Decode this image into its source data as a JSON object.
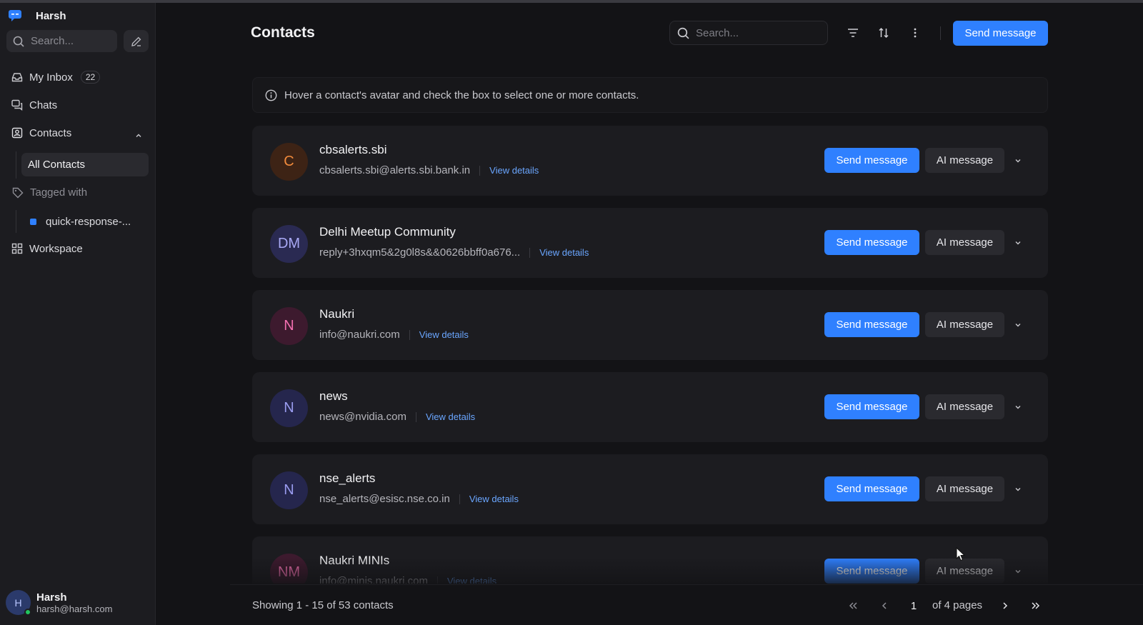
{
  "sidebar": {
    "brand": "Harsh",
    "search_placeholder": "Search...",
    "nav": {
      "inbox_label": "My Inbox",
      "inbox_count": "22",
      "chats_label": "Chats",
      "contacts_label": "Contacts",
      "all_contacts_label": "All Contacts",
      "tagged_label": "Tagged with",
      "tag_item_label": "quick-response-...",
      "workspace_label": "Workspace"
    },
    "user": {
      "initial": "H",
      "name": "Harsh",
      "email": "harsh@harsh.com"
    }
  },
  "header": {
    "title": "Contacts",
    "search_placeholder": "Search...",
    "send_message_label": "Send message"
  },
  "info": {
    "text": "Hover a contact's avatar and check the box to select one or more contacts."
  },
  "contacts": [
    {
      "initials": "C",
      "name": "cbsalerts.sbi",
      "email": "cbsalerts.sbi@alerts.sbi.bank.in",
      "view_label": "View details",
      "send_label": "Send message",
      "ai_label": "AI message"
    },
    {
      "initials": "DM",
      "name": "Delhi Meetup Community",
      "email": "reply+3hxqm5&2g0l8s&&0626bbff0a676...",
      "view_label": "View details",
      "send_label": "Send message",
      "ai_label": "AI message"
    },
    {
      "initials": "N",
      "name": "Naukri",
      "email": "info@naukri.com",
      "view_label": "View details",
      "send_label": "Send message",
      "ai_label": "AI message"
    },
    {
      "initials": "N",
      "name": "news",
      "email": "news@nvidia.com",
      "view_label": "View details",
      "send_label": "Send message",
      "ai_label": "AI message"
    },
    {
      "initials": "N",
      "name": "nse_alerts",
      "email": "nse_alerts@esisc.nse.co.in",
      "view_label": "View details",
      "send_label": "Send message",
      "ai_label": "AI message"
    },
    {
      "initials": "NM",
      "name": "Naukri MINIs",
      "email": "info@minis.naukri.com",
      "view_label": "View details",
      "send_label": "Send message",
      "ai_label": "AI message"
    }
  ],
  "avatar_colors": [
    {
      "bg": "#3d2315",
      "fg": "#f08a3c"
    },
    {
      "bg": "#2a2a52",
      "fg": "#a9a9f5"
    },
    {
      "bg": "#3d1a2e",
      "fg": "#f36fb0"
    },
    {
      "bg": "#25264d",
      "fg": "#9a9cf0"
    },
    {
      "bg": "#25264d",
      "fg": "#9a9cf0"
    },
    {
      "bg": "#3d1a2e",
      "fg": "#f36fb0"
    }
  ],
  "colors": {
    "accent": "#2f80ff",
    "link": "#6aa6ff",
    "background": "#131316",
    "online": "#22c55e"
  },
  "footer": {
    "showing": "Showing 1 - 15 of 53 contacts",
    "current_page": "1",
    "of_pages": "of 4 pages"
  }
}
